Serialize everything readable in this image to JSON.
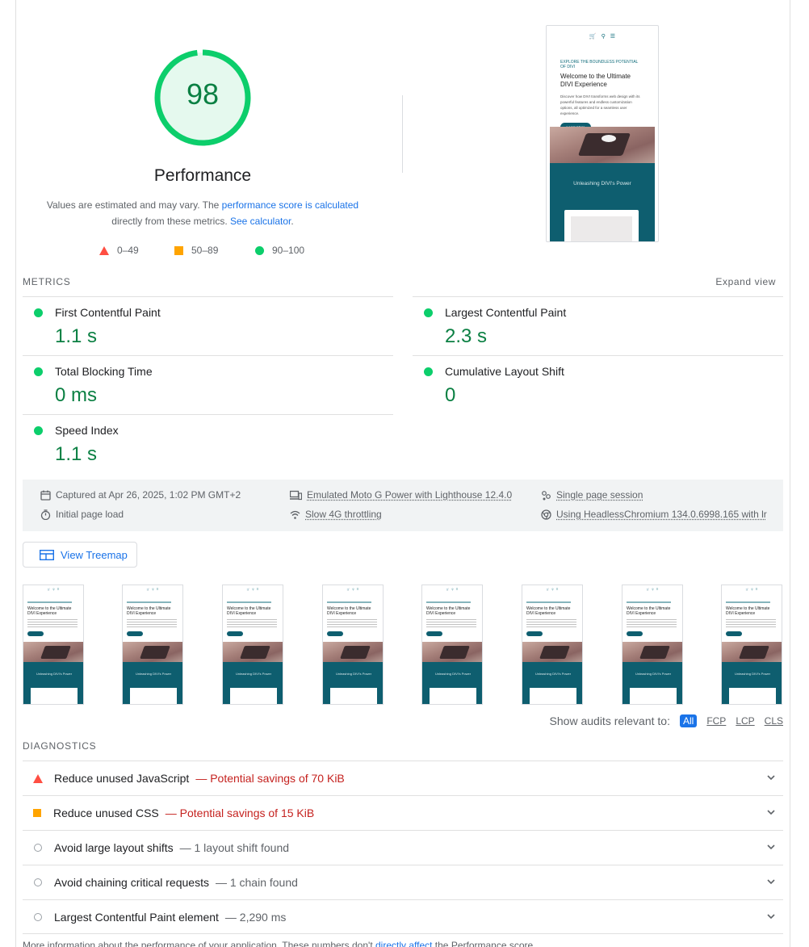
{
  "score": {
    "value": "98",
    "fraction": 0.98,
    "color": "#0cce6b",
    "title": "Performance",
    "desc_prefix": "Values are estimated and may vary. The ",
    "desc_link1": "performance score is calculated",
    "desc_mid": "directly from these metrics. ",
    "desc_link2": "See calculator",
    "desc_suffix": "."
  },
  "legend": {
    "fail": "0–49",
    "average": "50–89",
    "pass": "90–100"
  },
  "screenshot": {
    "kicker": "EXPLORE THE BOUNDLESS POTENTIAL OF DIVI",
    "heading": "Welcome to the Ultimate DIVI Experience",
    "body": "Discover how DIVI transforms web design with its powerful features and endless customization options, all optimized for a seamless user experience.",
    "button": "Learn More",
    "section": "Unleashing DIVI's Power"
  },
  "metrics": {
    "label": "METRICS",
    "expand": "Expand view",
    "fcp": {
      "name": "First Contentful Paint",
      "value": "1.1 s"
    },
    "lcp": {
      "name": "Largest Contentful Paint",
      "value": "2.3 s"
    },
    "tbt": {
      "name": "Total Blocking Time",
      "value": "0 ms"
    },
    "cls": {
      "name": "Cumulative Layout Shift",
      "value": "0"
    },
    "si": {
      "name": "Speed Index",
      "value": "1.1 s"
    }
  },
  "info": {
    "captured": "Captured at Apr 26, 2025, 1:02 PM GMT+2",
    "initial": "Initial page load",
    "device": "Emulated Moto G Power with Lighthouse 12.4.0",
    "throttle": "Slow 4G throttling",
    "session": "Single page session",
    "browser": "Using HeadlessChromium 134.0.6998.165 with lr"
  },
  "treemap": "View Treemap",
  "filters": {
    "label": "Show audits relevant to:",
    "all": "All",
    "fcp": "FCP",
    "lcp": "LCP",
    "cls": "CLS"
  },
  "diagnostics": {
    "label": "DIAGNOSTICS",
    "items": [
      {
        "title": "Reduce unused JavaScript",
        "savings": "— Potential savings of 70 KiB"
      },
      {
        "title": "Reduce unused CSS",
        "savings": "— Potential savings of 15 KiB"
      },
      {
        "title": "Avoid large layout shifts",
        "savings": "— 1 layout shift found"
      },
      {
        "title": "Avoid chaining critical requests",
        "savings": "— 1 chain found"
      },
      {
        "title": "Largest Contentful Paint element",
        "savings": "— 2,290 ms"
      }
    ]
  },
  "footer": {
    "prefix": "More information about the performance of your application. These numbers don't ",
    "link": "directly affect",
    "suffix": " the Performance score."
  }
}
